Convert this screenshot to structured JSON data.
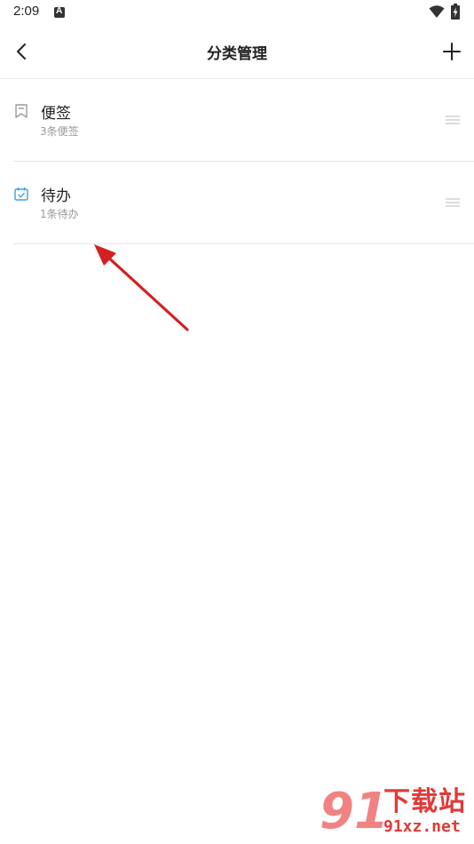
{
  "status_bar": {
    "time": "2:09",
    "notification_icon": "a-letter-icon",
    "wifi_icon": "wifi-icon",
    "battery_icon": "battery-charging-icon"
  },
  "header": {
    "title": "分类管理",
    "back_icon": "chevron-left-icon",
    "add_icon": "plus-icon"
  },
  "categories": [
    {
      "name": "便签",
      "sub": "3条便签",
      "icon": "bookmark-icon",
      "icon_color": "#9a9a9a"
    },
    {
      "name": "待办",
      "sub": "1条待办",
      "icon": "calendar-check-icon",
      "icon_color": "#3aa0e6"
    }
  ],
  "colors": {
    "annotation_arrow": "#d42020",
    "todo_accent": "#3aa0e6"
  },
  "watermark": {
    "number": "91",
    "title": "下载站",
    "site": "91xz.net"
  }
}
